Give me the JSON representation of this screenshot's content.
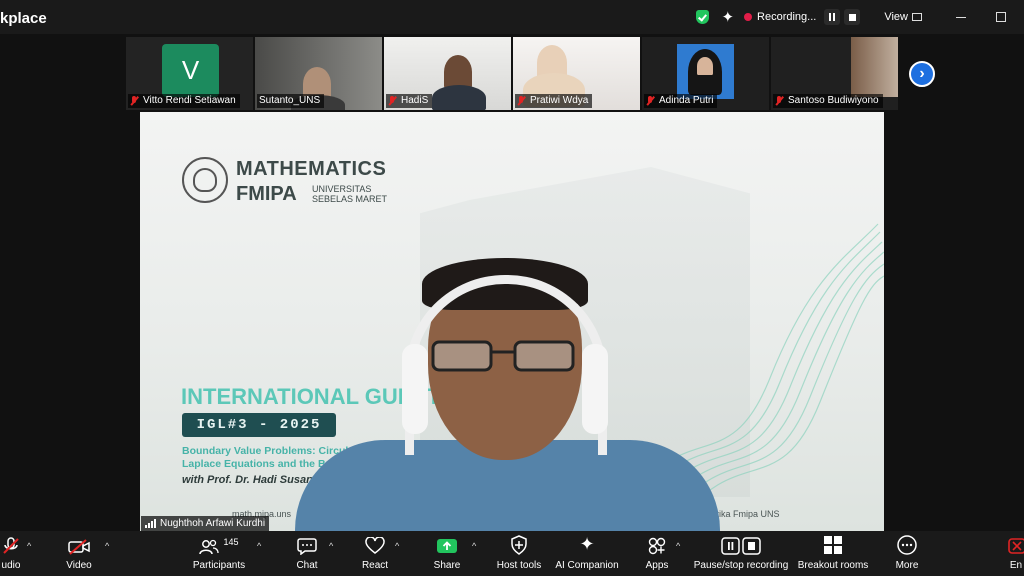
{
  "window": {
    "app_title": "kplace",
    "recording_label": "Recording...",
    "view_label": "View"
  },
  "participants": [
    {
      "name": "Vitto Rendi Setiawan",
      "muted": true,
      "avatar_letter": "V",
      "avatar_color": "#1c8b5e"
    },
    {
      "name": "Sutanto_UNS",
      "muted": false
    },
    {
      "name": "HadiS",
      "muted": true
    },
    {
      "name": "Pratiwi Wdya",
      "muted": true
    },
    {
      "name": "Adinda Putri",
      "muted": true
    },
    {
      "name": "Santoso Budiwiyono",
      "muted": true
    }
  ],
  "main_video": {
    "speaker_name": "Nughthoh Arfawi Kurdhi",
    "slide": {
      "brand_line1": "MATHEMATICS",
      "brand_line2": "FMIPA",
      "brand_line3": "UNIVERSITAS SEBELAS MARET",
      "event_title": "INTERNATIONAL GUEST",
      "event_badge": "IGL#3 - 2025",
      "topic_line1": "Boundary Value Problems: Circular Boundary Co",
      "topic_line2": "Laplace Equations and the Broader Poisson Fram",
      "presenter": "with Prof. Dr. Hadi Susanto",
      "footer_web": "math.mipa.uns",
      "footer_ig": "matika Fmipa UNS"
    }
  },
  "toolbar": {
    "audio": "udio",
    "video": "Video",
    "participants": "Participants",
    "participants_count": "145",
    "chat": "Chat",
    "react": "React",
    "share": "Share",
    "host_tools": "Host tools",
    "ai_companion": "AI Companion",
    "apps": "Apps",
    "pause_stop": "Pause/stop recording",
    "breakout": "Breakout rooms",
    "more": "More",
    "end": "En"
  },
  "colors": {
    "share_green": "#22c55e",
    "mute_red": "#e02424",
    "accent_blue": "#1d6fe0",
    "slide_teal": "#46b3a8"
  }
}
